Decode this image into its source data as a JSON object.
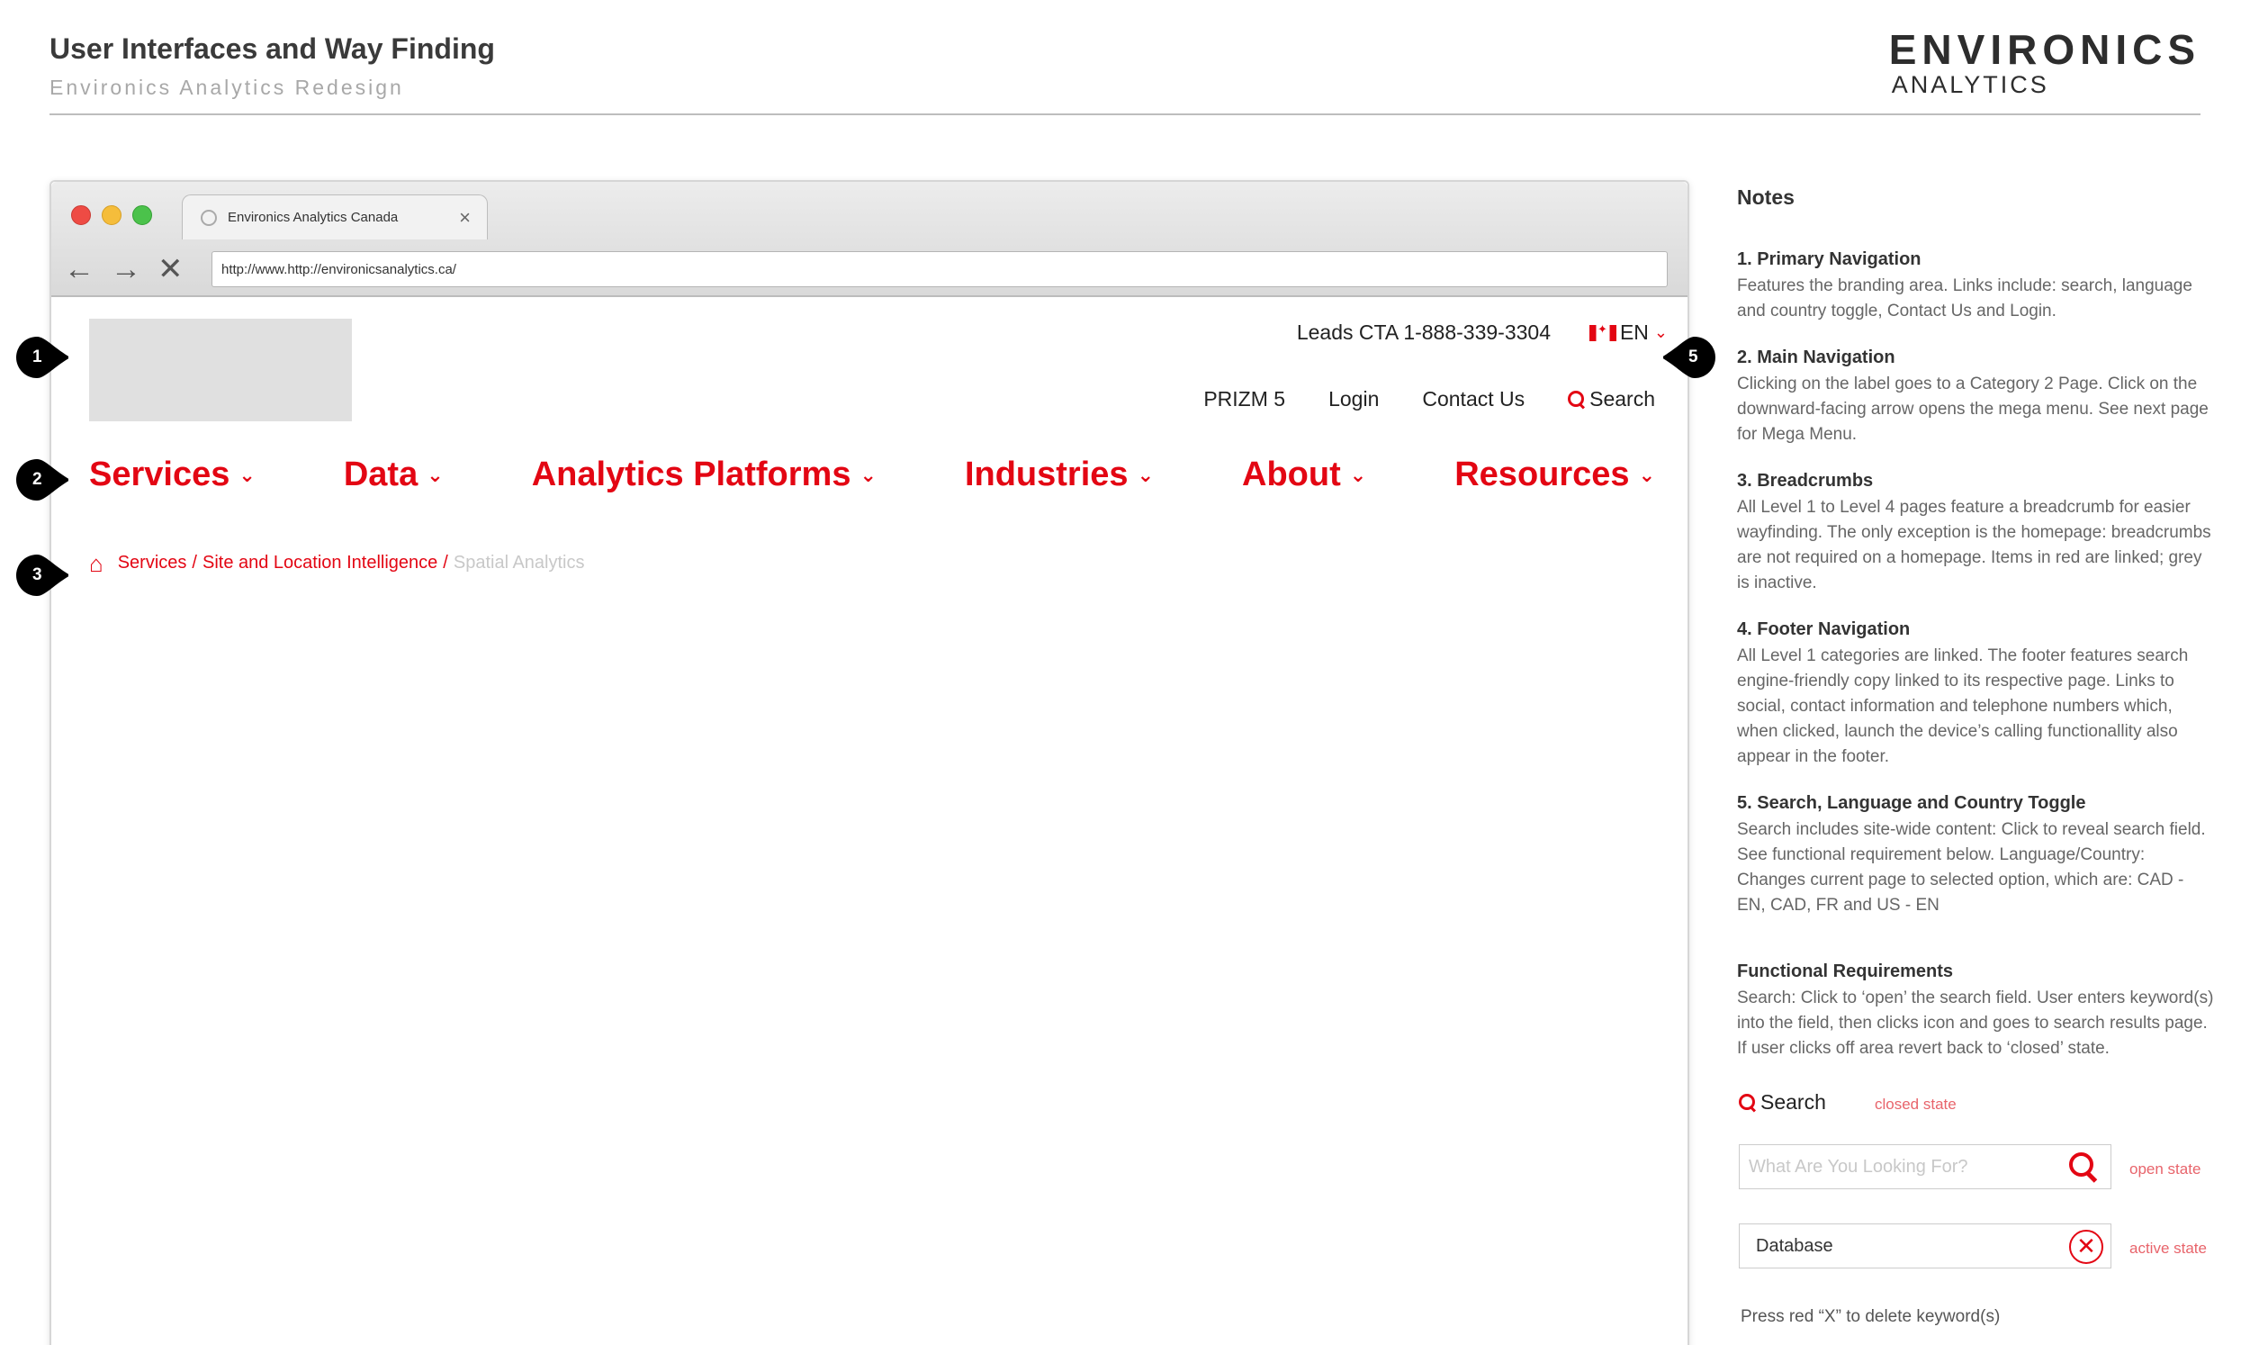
{
  "header": {
    "title": "User Interfaces and Way Finding",
    "subtitle": "Environics Analytics Redesign",
    "brand_name": "ENVIRONICS",
    "brand_sub": "ANALYTICS"
  },
  "browser": {
    "tab_label": "Environics Analytics Canada",
    "tab_close": "×",
    "url": "http://www.http://environicsanalytics.ca/",
    "back": "←",
    "forward": "→",
    "stop": "✕"
  },
  "site": {
    "leads": "Leads CTA 1-888-339-3304",
    "lang": "EN",
    "chevron": "⌄",
    "utility_links": [
      "PRIZM 5",
      "Login",
      "Contact Us",
      "Search"
    ],
    "main_nav": [
      "Services",
      "Data",
      "Analytics Platforms",
      "Industries",
      "About",
      "Resources"
    ],
    "breadcrumb": {
      "home_icon": "⌂",
      "linked": [
        "Services",
        "Site and Location Intelligence"
      ],
      "separator": "/",
      "inactive": "Spatial Analytics"
    }
  },
  "markers": [
    "1",
    "2",
    "3",
    "5"
  ],
  "notes": {
    "title": "Notes",
    "items": [
      {
        "heading": "1. Primary Navigation",
        "body": "Features the branding area. Links include: search, language and country toggle, Contact Us and Login."
      },
      {
        "heading": "2. Main Navigation",
        "body": "Clicking on the label goes to a Category 2 Page. Click on the downward-facing arrow opens the mega menu. See next page for Mega Menu."
      },
      {
        "heading": "3. Breadcrumbs",
        "body": "All Level 1 to Level 4 pages feature a breadcrumb for easier wayfinding. The only exception is the homepage: breadcrumbs are not required on a homepage. Items in red are linked; grey is inactive."
      },
      {
        "heading": "4. Footer Navigation",
        "body": "All Level 1 categories are linked. The footer features search engine-friendly copy linked to its respective page. Links to social, contact information and telephone numbers which, when clicked, launch the device’s calling functionallity also appear in the footer."
      },
      {
        "heading": "5. Search, Language and Country Toggle",
        "body": "Search includes site-wide content: Click to reveal search field. See functional requirement below. Language/Country: Changes current page to selected option, which are: CAD - EN, CAD, FR and US - EN"
      }
    ],
    "functional": {
      "heading": "Functional Requirements",
      "body": "Search: Click to ‘open’ the search field. User enters keyword(s) into the field, then clicks icon and goes to search results page. If user clicks off area revert back to ‘closed’ state.",
      "closed_label": "Search",
      "closed_state": "closed state",
      "open_placeholder": "What Are You Looking For?",
      "open_state": "open state",
      "active_value": "Database",
      "active_state": "active state",
      "clear_glyph": "✕",
      "press_note": "Press red “X” to delete keyword(s)"
    }
  },
  "colors": {
    "accent": "#e30613",
    "inactive": "#c8c8c8",
    "state_label": "#e8646b"
  }
}
